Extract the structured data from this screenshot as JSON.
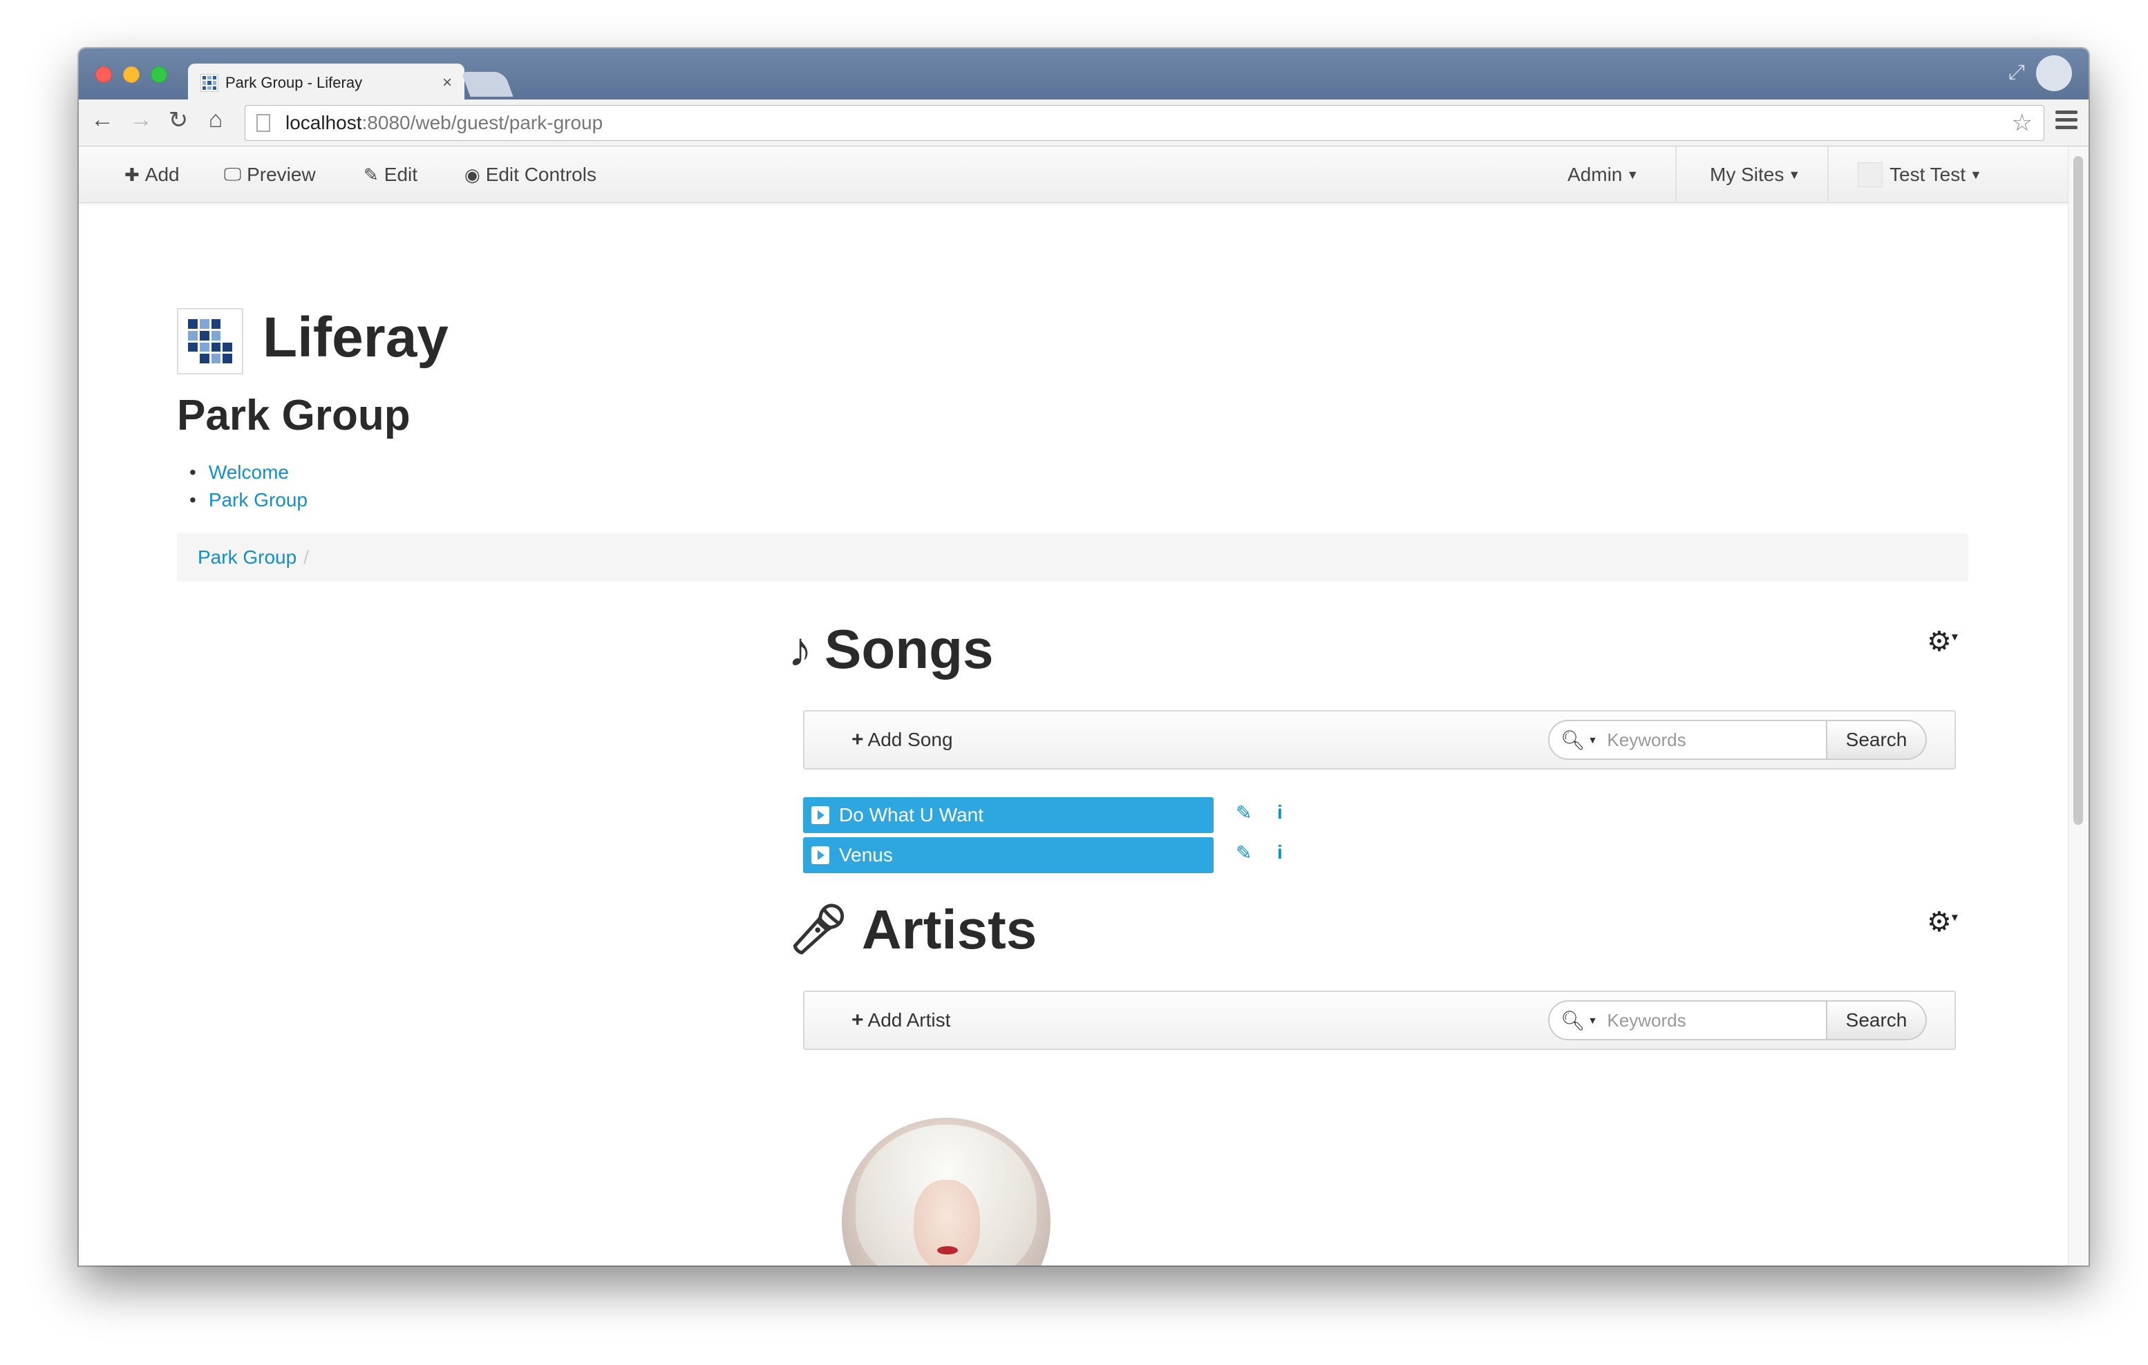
{
  "browser": {
    "tab_title": "Park Group - Liferay",
    "tab_close": "×",
    "url_host": "localhost",
    "url_rest": ":8080/web/guest/park-group"
  },
  "dockbar": {
    "add": "Add",
    "preview": "Preview",
    "edit": "Edit",
    "edit_controls": "Edit Controls",
    "admin": "Admin",
    "my_sites": "My Sites",
    "user": "Test Test"
  },
  "site": {
    "name": "Liferay",
    "group": "Park Group",
    "nav": [
      "Welcome",
      "Park Group"
    ],
    "breadcrumb": "Park Group",
    "breadcrumb_sep": "/"
  },
  "songs": {
    "title": "Songs",
    "add_label": "Add Song",
    "search_placeholder": "Keywords",
    "search_label": "Search",
    "items": [
      "Do What U Want",
      "Venus"
    ]
  },
  "artists": {
    "title": "Artists",
    "add_label": "Add Artist",
    "search_placeholder": "Keywords",
    "search_label": "Search"
  },
  "colors": {
    "accent": "#2ea7e0",
    "link": "#0e90d2"
  }
}
